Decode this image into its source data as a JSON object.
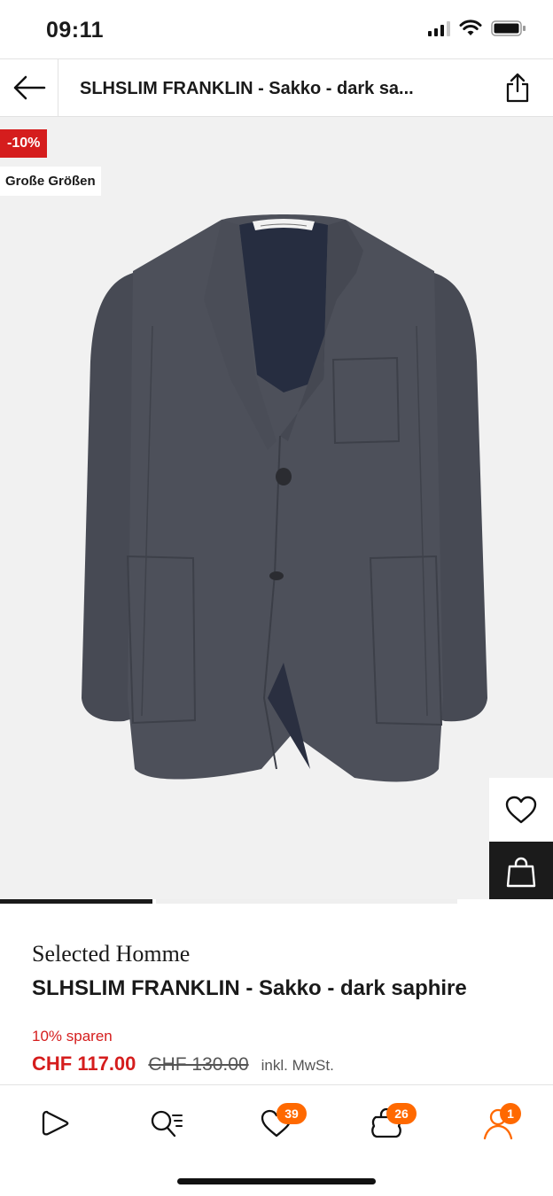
{
  "status_bar": {
    "time": "09:11"
  },
  "header": {
    "title": "SLHSLIM FRANKLIN - Sakko - dark sa...",
    "back_icon": "arrow-left-icon",
    "share_icon": "share-icon"
  },
  "gallery": {
    "badges": {
      "discount": "-10%",
      "size": "Große Größen"
    },
    "current_image": 1,
    "wishlist_icon": "heart-icon",
    "add_to_bag_icon": "shopping-bag-icon"
  },
  "product": {
    "brand": "Selected Homme",
    "name": "SLHSLIM FRANKLIN - Sakko - dark saphire",
    "savings": "10% sparen",
    "price_current": "CHF 117.00",
    "price_original": "CHF 130.00",
    "vat_note": "inkl. MwSt."
  },
  "bottom_nav": {
    "items": [
      {
        "name": "home",
        "icon": "play-outline-icon"
      },
      {
        "name": "search",
        "icon": "search-list-icon"
      },
      {
        "name": "wishlist",
        "icon": "heart-icon",
        "badge": "39"
      },
      {
        "name": "bag",
        "icon": "shopping-bag-icon",
        "badge": "26"
      },
      {
        "name": "account",
        "icon": "user-icon",
        "badge": "1"
      }
    ]
  },
  "colors": {
    "accent_red": "#d51d1d",
    "badge_orange": "#ff6900",
    "jacket": "#4a4d57"
  }
}
